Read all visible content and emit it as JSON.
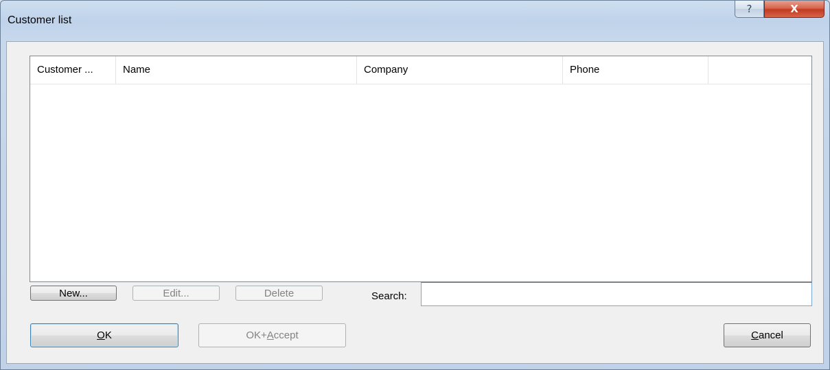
{
  "window": {
    "title": "Customer list",
    "help_label": "?",
    "close_label": "X"
  },
  "list": {
    "columns": [
      "Customer ...",
      "Name",
      "Company",
      "Phone",
      ""
    ],
    "rows": []
  },
  "toolbar": {
    "new_label": "New...",
    "edit_label": "Edit...",
    "delete_label": "Delete",
    "search_label": "Search:",
    "search_value": ""
  },
  "footer": {
    "ok_mnemonic": "O",
    "ok_rest": "K",
    "ok_accept_prefix": "OK+",
    "ok_accept_mnemonic": "A",
    "ok_accept_rest": "ccept",
    "cancel_mnemonic": "C",
    "cancel_rest": "ancel"
  }
}
